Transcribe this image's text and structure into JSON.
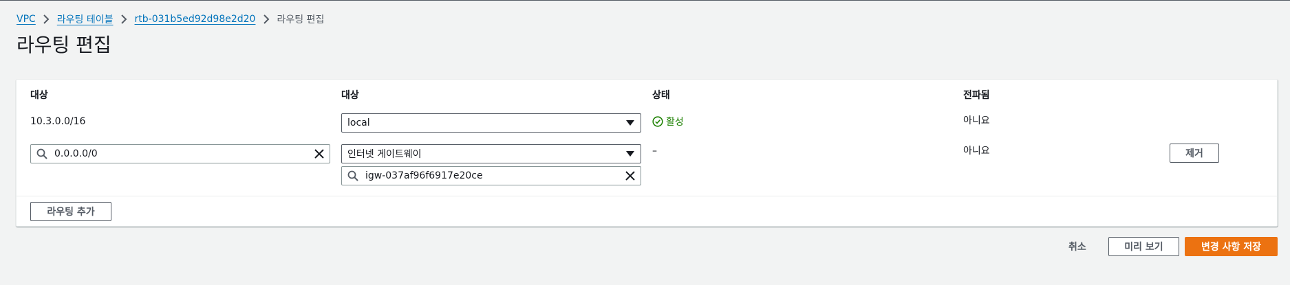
{
  "breadcrumb": {
    "items": [
      "VPC",
      "라우팅 테이블",
      "rtb-031b5ed92d98e2d20"
    ],
    "current": "라우팅 편집"
  },
  "page_title": "라우팅 편집",
  "routes_table": {
    "headers": {
      "destination": "대상",
      "target": "대상",
      "status": "상태",
      "propagated": "전파됨"
    },
    "rows": [
      {
        "destination": "10.3.0.0/16",
        "target": "local",
        "status": "활성",
        "propagated": "아니요"
      },
      {
        "destination": "0.0.0.0/0",
        "target": "인터넷 게이트웨이",
        "target_id": "igw-037af96f6917e20ce",
        "status": "–",
        "propagated": "아니요",
        "remove_label": "제거"
      }
    ],
    "add_route_label": "라우팅 추가"
  },
  "footer": {
    "cancel_label": "취소",
    "preview_label": "미리 보기",
    "save_label": "변경 사항 저장"
  },
  "colors": {
    "link": "#0073bb",
    "primary_button": "#ec7211",
    "status_active": "#1d8102",
    "background": "#f2f3f3"
  },
  "icons": [
    "chevron-right-icon",
    "search-icon",
    "clear-icon",
    "caret-down-icon",
    "check-circle-icon"
  ]
}
